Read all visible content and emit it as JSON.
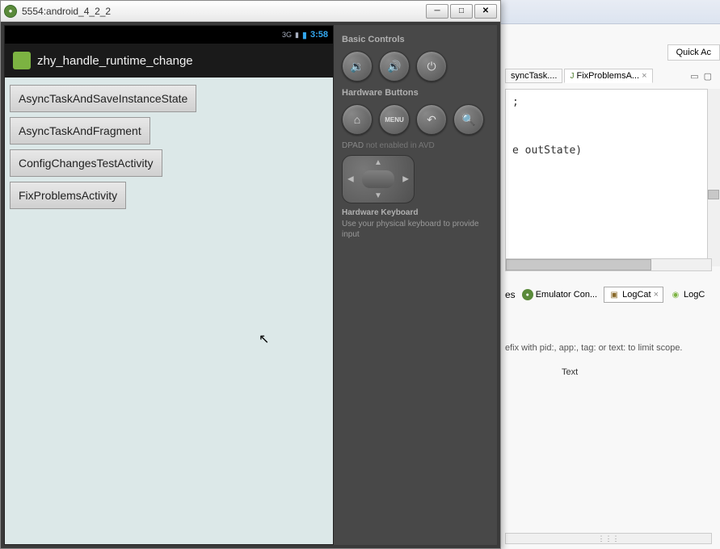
{
  "emulator": {
    "window_title": "5554:android_4_2_2",
    "status": {
      "network": "3G",
      "time": "3:58"
    },
    "app": {
      "title": "zhy_handle_runtime_change",
      "buttons": [
        "AsyncTaskAndSaveInstanceState",
        "AsyncTaskAndFragment",
        "ConfigChangesTestActivity",
        "FixProblemsActivity"
      ]
    },
    "controls": {
      "basic_label": "Basic Controls",
      "hardware_label": "Hardware Buttons",
      "dpad_label": "DPAD",
      "dpad_status": "not enabled in AVD",
      "keyboard_label": "Hardware Keyboard",
      "keyboard_hint": "Use your physical keyboard to provide input",
      "menu_text": "MENU"
    }
  },
  "ide": {
    "quick_access": "Quick Ac",
    "tabs": [
      {
        "label": "syncTask...."
      },
      {
        "label": "FixProblemsA..."
      }
    ],
    "code_fragment_1": ";",
    "code_fragment_2": "e outState)",
    "bottom_tabs": {
      "emulator": "Emulator Con...",
      "logcat": "LogCat",
      "logcat2": "LogC"
    },
    "filter_hint": "efix with pid:, app:, tag: or text: to limit scope.",
    "column_header": "Text",
    "toolbar_close": "×"
  }
}
